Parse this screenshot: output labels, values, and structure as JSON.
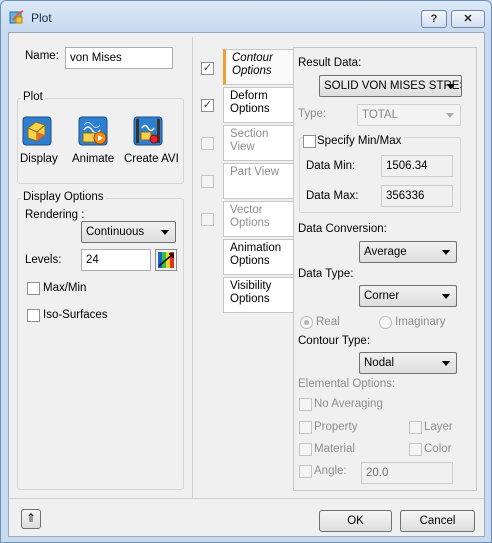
{
  "window": {
    "title": "Plot",
    "help_btn": "?",
    "close_btn": "✕"
  },
  "name": {
    "label": "Name:",
    "value": "von Mises"
  },
  "plot_group": {
    "label": "Plot",
    "display": "Display",
    "animate": "Animate",
    "create_avi": "Create AVI"
  },
  "display_options": {
    "label": "Display Options",
    "rendering_label": "Rendering :",
    "rendering_value": "Continuous",
    "levels_label": "Levels:",
    "levels_value": "24",
    "maxmin": "Max/Min",
    "iso": "Iso-Surfaces"
  },
  "tabs": {
    "contour": "Contour Options",
    "deform": "Deform Options",
    "section": "Section View",
    "part": "Part View",
    "vector": "Vector Options",
    "animation": "Animation Options",
    "visibility": "Visibility Options"
  },
  "contour": {
    "result_label": "Result Data:",
    "result_value": "SOLID VON MISES STRES",
    "type_label": "Type:",
    "type_value": "TOTAL",
    "specify_label": "Specify Min/Max",
    "data_min_label": "Data Min:",
    "data_min_value": "1506.34",
    "data_max_label": "Data Max:",
    "data_max_value": "356336",
    "conversion_label": "Data Conversion:",
    "conversion_value": "Average",
    "data_type_label": "Data Type:",
    "data_type_value": "Corner",
    "real": "Real",
    "imaginary": "Imaginary",
    "contour_type_label": "Contour Type:",
    "contour_type_value": "Nodal",
    "elemental_label": "Elemental Options:",
    "no_averaging": "No Averaging",
    "property": "Property",
    "layer": "Layer",
    "material": "Material",
    "color": "Color",
    "angle_label": "Angle:",
    "angle_value": "20.0"
  },
  "footer": {
    "collapse": "⇑",
    "ok": "OK",
    "cancel": "Cancel"
  },
  "checks": {
    "check_mark": "✓"
  }
}
